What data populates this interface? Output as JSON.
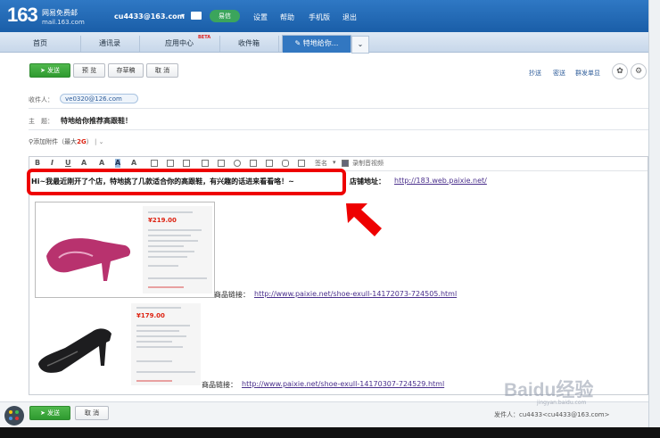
{
  "header": {
    "logo": "163",
    "logo_sub1": "网易免费邮",
    "logo_sub2": "mail.163.com",
    "account": "cu4433@163.com",
    "account_arrow": "▾",
    "yixin": "易信",
    "links": [
      "设置",
      "帮助",
      "手机版",
      "退出"
    ]
  },
  "tabs": {
    "items": [
      "首页",
      "通讯录",
      "应用中心",
      "收件箱"
    ],
    "new_badge": "BETA",
    "active": "特地给你...",
    "more": "⌄"
  },
  "compose_toolbar": {
    "send": "发送",
    "preview": "预 览",
    "draft": "存草稿",
    "cancel": "取 消",
    "right_links": [
      "抄送",
      "密送",
      "群发单显"
    ]
  },
  "fields": {
    "to_label": "收件人：",
    "recipient": "ve0320@126.com",
    "subject_label": "主　题：",
    "subject": "特地给你推荐高跟鞋！",
    "attach_label": "添加附件",
    "attach_limit_prefix": "（最大",
    "attach_limit": "2G",
    "attach_limit_suffix": "）"
  },
  "editor_toolbar": {
    "items": [
      "B",
      "I",
      "U",
      "A",
      "A",
      "A",
      "A"
    ],
    "signature": "签名",
    "record_video": "录制音视频"
  },
  "body": {
    "message": "Hi~我最近刚开了个店，特地挑了几款适合你的高跟鞋，有兴趣的话进来看看咯！~",
    "shop_label": "店铺地址：",
    "shop_url": "http://183.web.paixie.net/",
    "products": [
      {
        "price": "¥219.00",
        "label": "商品链接：",
        "url": "http://www.paixie.net/shoe-exull-14172073-724505.html",
        "shoe_color": "#b8326e"
      },
      {
        "price": "¥179.00",
        "label": "商品链接：",
        "url": "http://www.paixie.net/shoe-exull-14170307-724529.html",
        "shoe_color": "#1d1d1f"
      }
    ]
  },
  "footer": {
    "send": "发送",
    "cancel": "取 消",
    "sender": "发件人：cu4433<cu4433@163.com>"
  },
  "watermark": "Baidu经验",
  "watermark_sub": "jingyan.baidu.com",
  "colors": {
    "topbar": "#1a5ea8",
    "send_green": "#2f9a30",
    "highlight_red": "#ee0000",
    "link_purple": "#4a2f8c"
  }
}
